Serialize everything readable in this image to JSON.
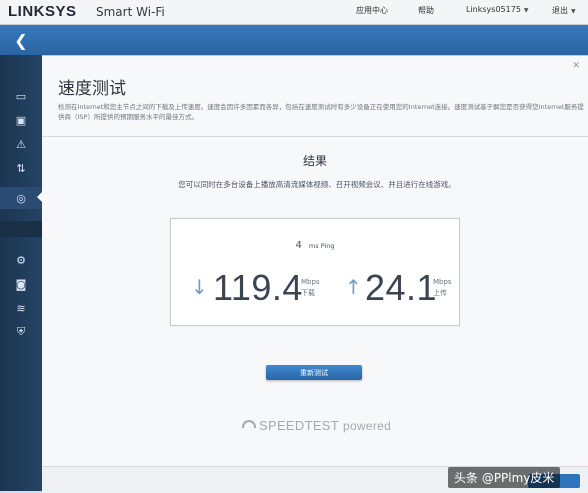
{
  "header": {
    "logo": "LINKSYS",
    "product": "Smart Wi-Fi",
    "nav": [
      "应用中心",
      "帮助",
      "Linksys05175",
      "退出"
    ]
  },
  "page": {
    "title": "速度测试",
    "description": "检测在Internet和您主节点之间的下载及上传速度。速度会因许多因素而各异，包括在速度测试时有多少设备正在使用您的Internet连接。速度测试基于解您是否获得您Internet服务提供商（ISP）所提供的预期服务水平的最佳方式。"
  },
  "result": {
    "title": "结果",
    "summary": "您可以同时在多台设备上播放高清流媒体视频、召开视频会议、并且进行在线游戏。",
    "ping_value": "4",
    "ping_unit": "ms Ping",
    "download_value": "119.4",
    "download_unit": "Mbps",
    "download_label": "下载",
    "upload_value": "24.1",
    "upload_unit": "Mbps",
    "upload_label": "上传"
  },
  "actions": {
    "retest": "重新测试"
  },
  "branding": {
    "speedtest": "SPEEDTEST",
    "powered": "powered"
  },
  "watermark": "头条 @PPlmy皮米",
  "colors": {
    "accent_blue": "#2f74ba",
    "sidebar": "#1f3a57",
    "arrow": "#6f9ec8"
  }
}
